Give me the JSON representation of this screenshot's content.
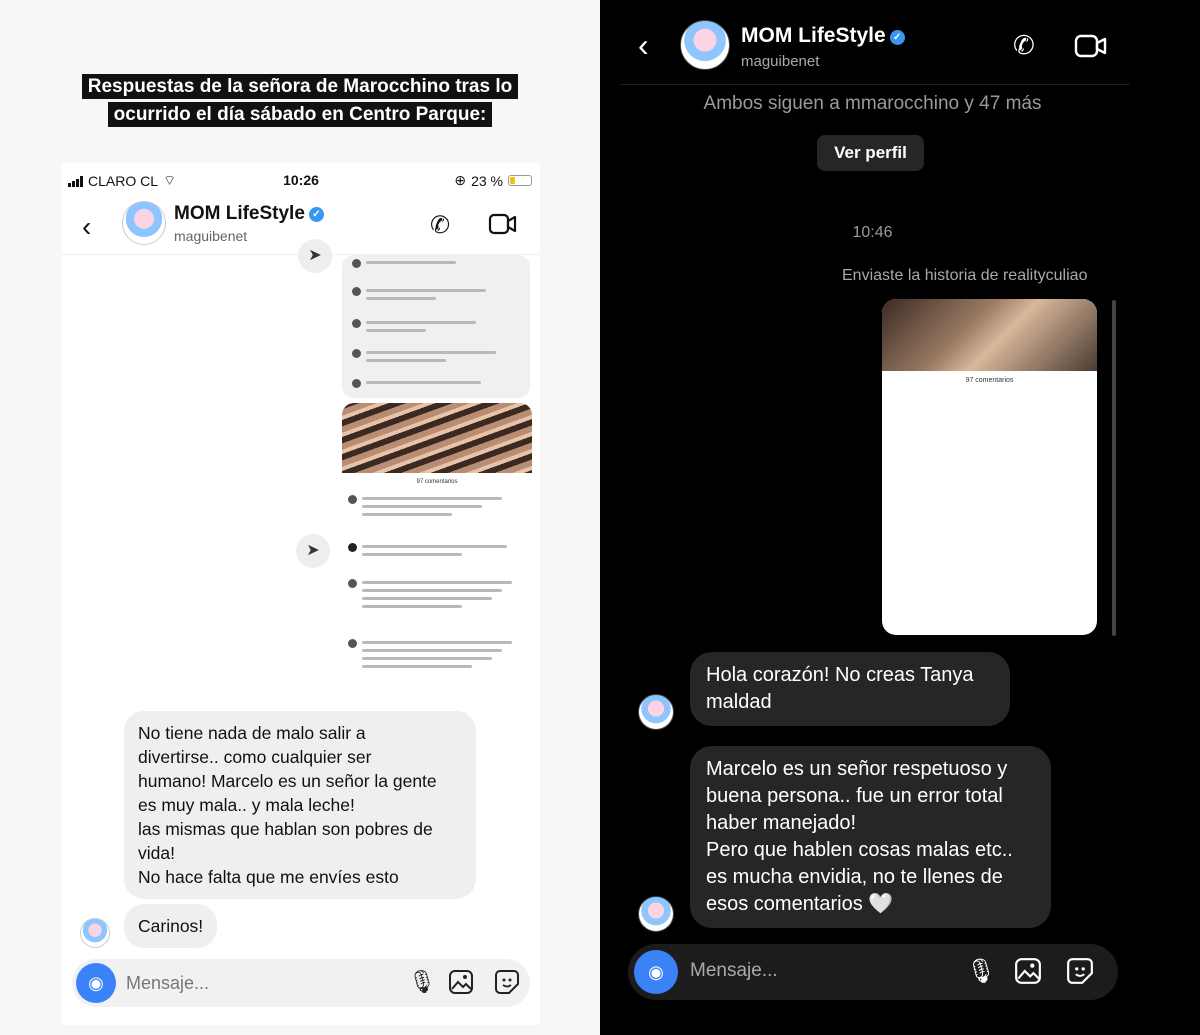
{
  "left": {
    "headline": "Respuestas de la señora de Marocchino tras lo ocurrido el día sábado en Centro Parque:",
    "status": {
      "carrier": "CLARO CL",
      "time": "10:26",
      "battery": "23 %"
    },
    "header": {
      "name": "MOM LifeStyle",
      "handle": "maguibenet"
    },
    "screenshot_comments_title": "97 comentarios",
    "messages": [
      "No tiene nada de malo salir a",
      "divertirse.. como cualquier ser",
      "humano! Marcelo es un señor la gente",
      "es muy mala.. y mala leche!",
      "las mismas que hablan son pobres de",
      "vida!",
      "No hace falta que me envíes esto"
    ],
    "last_message": "Carinos!",
    "composer_placeholder": "Mensaje..."
  },
  "right": {
    "header": {
      "name": "MOM LifeStyle",
      "handle": "maguibenet"
    },
    "follow_info": "Ambos siguen a mmarocchino y 47 más",
    "profile_button": "Ver perfil",
    "time": "10:46",
    "story_note": "Enviaste la historia de realityculiao",
    "story_comments_title": "97 comentarios",
    "message1": [
      "Hola corazón! No creas Tanya",
      "maldad"
    ],
    "message2": [
      "Marcelo es un señor respetuoso y",
      "buena persona.. fue un error total",
      "haber manejado!",
      "Pero que hablen cosas malas etc..",
      "es mucha envidia, no te llenes de",
      "esos comentarios 🤍"
    ],
    "composer_placeholder": "Mensaje..."
  },
  "colors": {
    "verified": "#3897f0",
    "camera_button": "#3b82f6",
    "dark_bubble": "#262626",
    "light_bubble": "#efefef"
  },
  "icons": [
    "back-icon",
    "phone-icon",
    "video-icon",
    "camera-icon",
    "microphone-icon",
    "gallery-icon",
    "sticker-icon",
    "share-icon",
    "verified-icon"
  ]
}
